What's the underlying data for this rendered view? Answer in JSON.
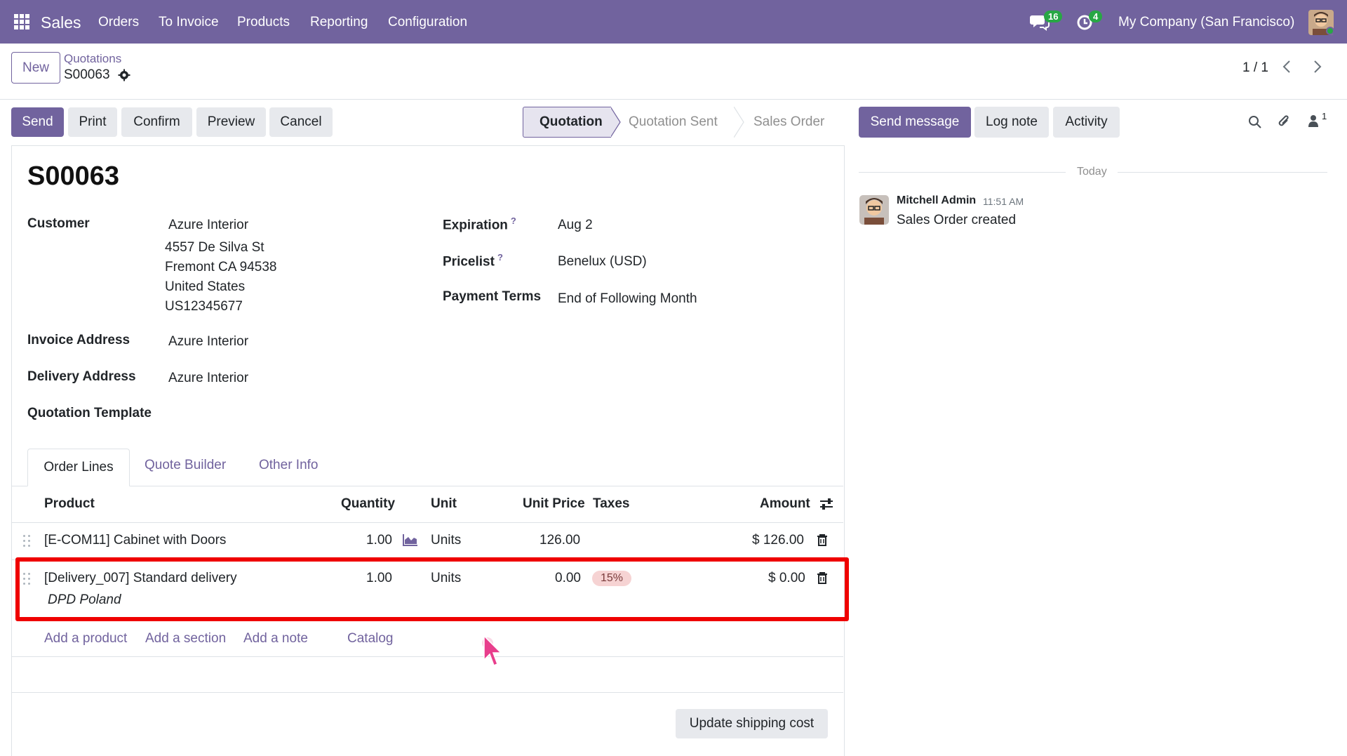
{
  "topbar": {
    "app_name": "Sales",
    "menu": [
      "Orders",
      "To Invoice",
      "Products",
      "Reporting",
      "Configuration"
    ],
    "messages_badge": "16",
    "activities_badge": "4",
    "company": "My Company (San Francisco)"
  },
  "control": {
    "new_label": "New",
    "breadcrumb_parent": "Quotations",
    "breadcrumb_current": "S00063",
    "pager": "1 / 1"
  },
  "actions": {
    "send": "Send",
    "print": "Print",
    "confirm": "Confirm",
    "preview": "Preview",
    "cancel": "Cancel"
  },
  "statusbar": {
    "stages": [
      "Quotation",
      "Quotation Sent",
      "Sales Order"
    ],
    "active": "Quotation"
  },
  "form": {
    "title": "S00063",
    "customer_label": "Customer",
    "customer_name": "Azure Interior",
    "customer_address": [
      "4557 De Silva St",
      "Fremont CA 94538",
      "United States",
      "US12345677"
    ],
    "invoice_address_label": "Invoice Address",
    "invoice_address": "Azure Interior",
    "delivery_address_label": "Delivery Address",
    "delivery_address": "Azure Interior",
    "quotation_template_label": "Quotation Template",
    "expiration_label": "Expiration",
    "expiration": "Aug 2",
    "pricelist_label": "Pricelist",
    "pricelist": "Benelux (USD)",
    "payment_terms_label": "Payment Terms",
    "payment_terms": "End of Following Month",
    "help_mark": "?"
  },
  "tabs": [
    "Order Lines",
    "Quote Builder",
    "Other Info"
  ],
  "order_lines": {
    "headers": {
      "product": "Product",
      "quantity": "Quantity",
      "unit": "Unit",
      "unit_price": "Unit Price",
      "taxes": "Taxes",
      "amount": "Amount"
    },
    "rows": [
      {
        "product": "[E-COM11] Cabinet with Doors",
        "description": "",
        "quantity": "1.00",
        "unit": "Units",
        "unit_price": "126.00",
        "taxes": "",
        "amount": "$ 126.00"
      },
      {
        "product": "[Delivery_007] Standard delivery",
        "description": "DPD Poland",
        "quantity": "1.00",
        "unit": "Units",
        "unit_price": "0.00",
        "taxes": "15%",
        "amount": "$ 0.00"
      }
    ],
    "add_product": "Add a product",
    "add_section": "Add a section",
    "add_note": "Add a note",
    "catalog": "Catalog",
    "update_shipping": "Update shipping cost"
  },
  "chatter": {
    "send_message": "Send message",
    "log_note": "Log note",
    "activity": "Activity",
    "followers_count": "1",
    "date_separator": "Today",
    "message": {
      "author": "Mitchell Admin",
      "time": "11:51 AM",
      "body": "Sales Order created"
    }
  },
  "colors": {
    "brand": "#71639e",
    "highlight": "#ef0000",
    "tax_tag_bg": "#f6d3d3"
  }
}
